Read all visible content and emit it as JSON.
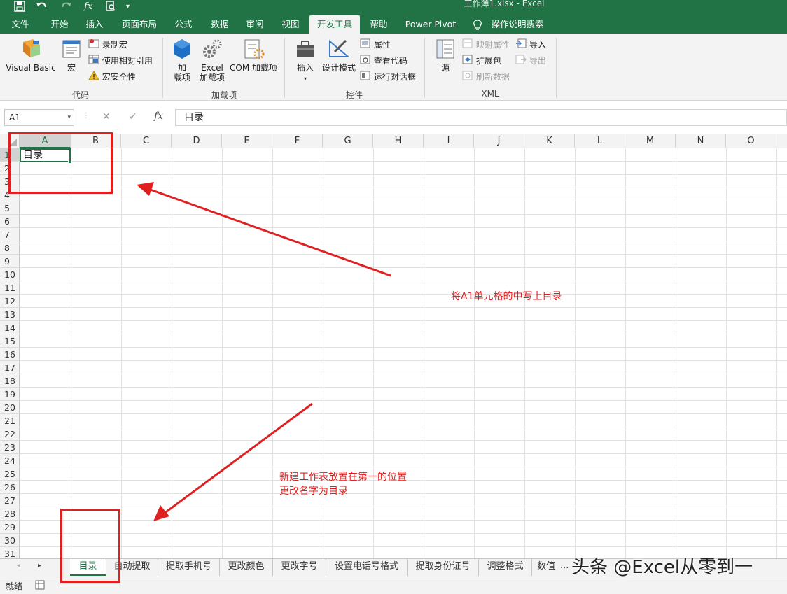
{
  "window": {
    "title": "工作薄1.xlsx  -  Excel"
  },
  "quick_access": {
    "save_icon": "save-icon",
    "undo_icon": "undo-icon",
    "redo_icon": "redo-icon",
    "fx": "fx",
    "preview_icon": "print-preview-icon"
  },
  "ribbon_tabs": [
    "文件",
    "开始",
    "插入",
    "页面布局",
    "公式",
    "数据",
    "审阅",
    "视图",
    "开发工具",
    "帮助",
    "Power Pivot",
    "操作说明搜索"
  ],
  "active_tab": "开发工具",
  "ribbon": {
    "code": {
      "label": "代码",
      "visual_basic": "Visual Basic",
      "macro": "宏",
      "record_macro": "录制宏",
      "relative_ref": "使用相对引用",
      "macro_security": "宏安全性"
    },
    "addins": {
      "label": "加载项",
      "addins_line1": "加",
      "addins_line2": "载项",
      "excel_addins_line1": "Excel",
      "excel_addins_line2": "加载项",
      "com_addins": "COM 加载项"
    },
    "controls": {
      "label": "控件",
      "insert": "插入",
      "design_mode": "设计模式",
      "properties": "属性",
      "view_code": "查看代码",
      "run_dialog": "运行对话框"
    },
    "xml": {
      "label": "XML",
      "source": "源",
      "map_properties": "映射属性",
      "expansion_packs": "扩展包",
      "refresh_data": "刷新数据",
      "import": "导入",
      "export": "导出"
    }
  },
  "formula_bar": {
    "name_box": "A1",
    "cancel": "✕",
    "enter": "✓",
    "fx": "fx",
    "content": "目录"
  },
  "grid": {
    "columns": [
      "A",
      "B",
      "C",
      "D",
      "E",
      "F",
      "G",
      "H",
      "I",
      "J",
      "K",
      "L",
      "M",
      "N",
      "O"
    ],
    "rows": [
      "1",
      "2",
      "3",
      "4",
      "5",
      "6",
      "7",
      "8",
      "9",
      "10",
      "11",
      "12",
      "13",
      "14",
      "15",
      "16",
      "17",
      "18",
      "19",
      "20",
      "21",
      "22",
      "23",
      "24",
      "25",
      "26",
      "27",
      "28",
      "29",
      "30",
      "31"
    ],
    "selected_cell": "A1",
    "a1_value": "目录"
  },
  "annotations": {
    "note1": "将A1单元格的中写上目录",
    "note2_line1": "新建工作表放置在第一的位置",
    "note2_line2": "更改名字为目录",
    "color": "#e02020"
  },
  "sheet_tabs": [
    "目录",
    "自动提取",
    "提取手机号",
    "更改颜色",
    "更改字号",
    "设置电话号格式",
    "提取身份证号",
    "调整格式",
    "数值"
  ],
  "sheet_more": "...",
  "status": {
    "ready": "就绪"
  },
  "watermark": "头条 @Excel从零到一",
  "colors": {
    "accent": "#217346",
    "ribbon_bg": "#f3f3f3"
  }
}
